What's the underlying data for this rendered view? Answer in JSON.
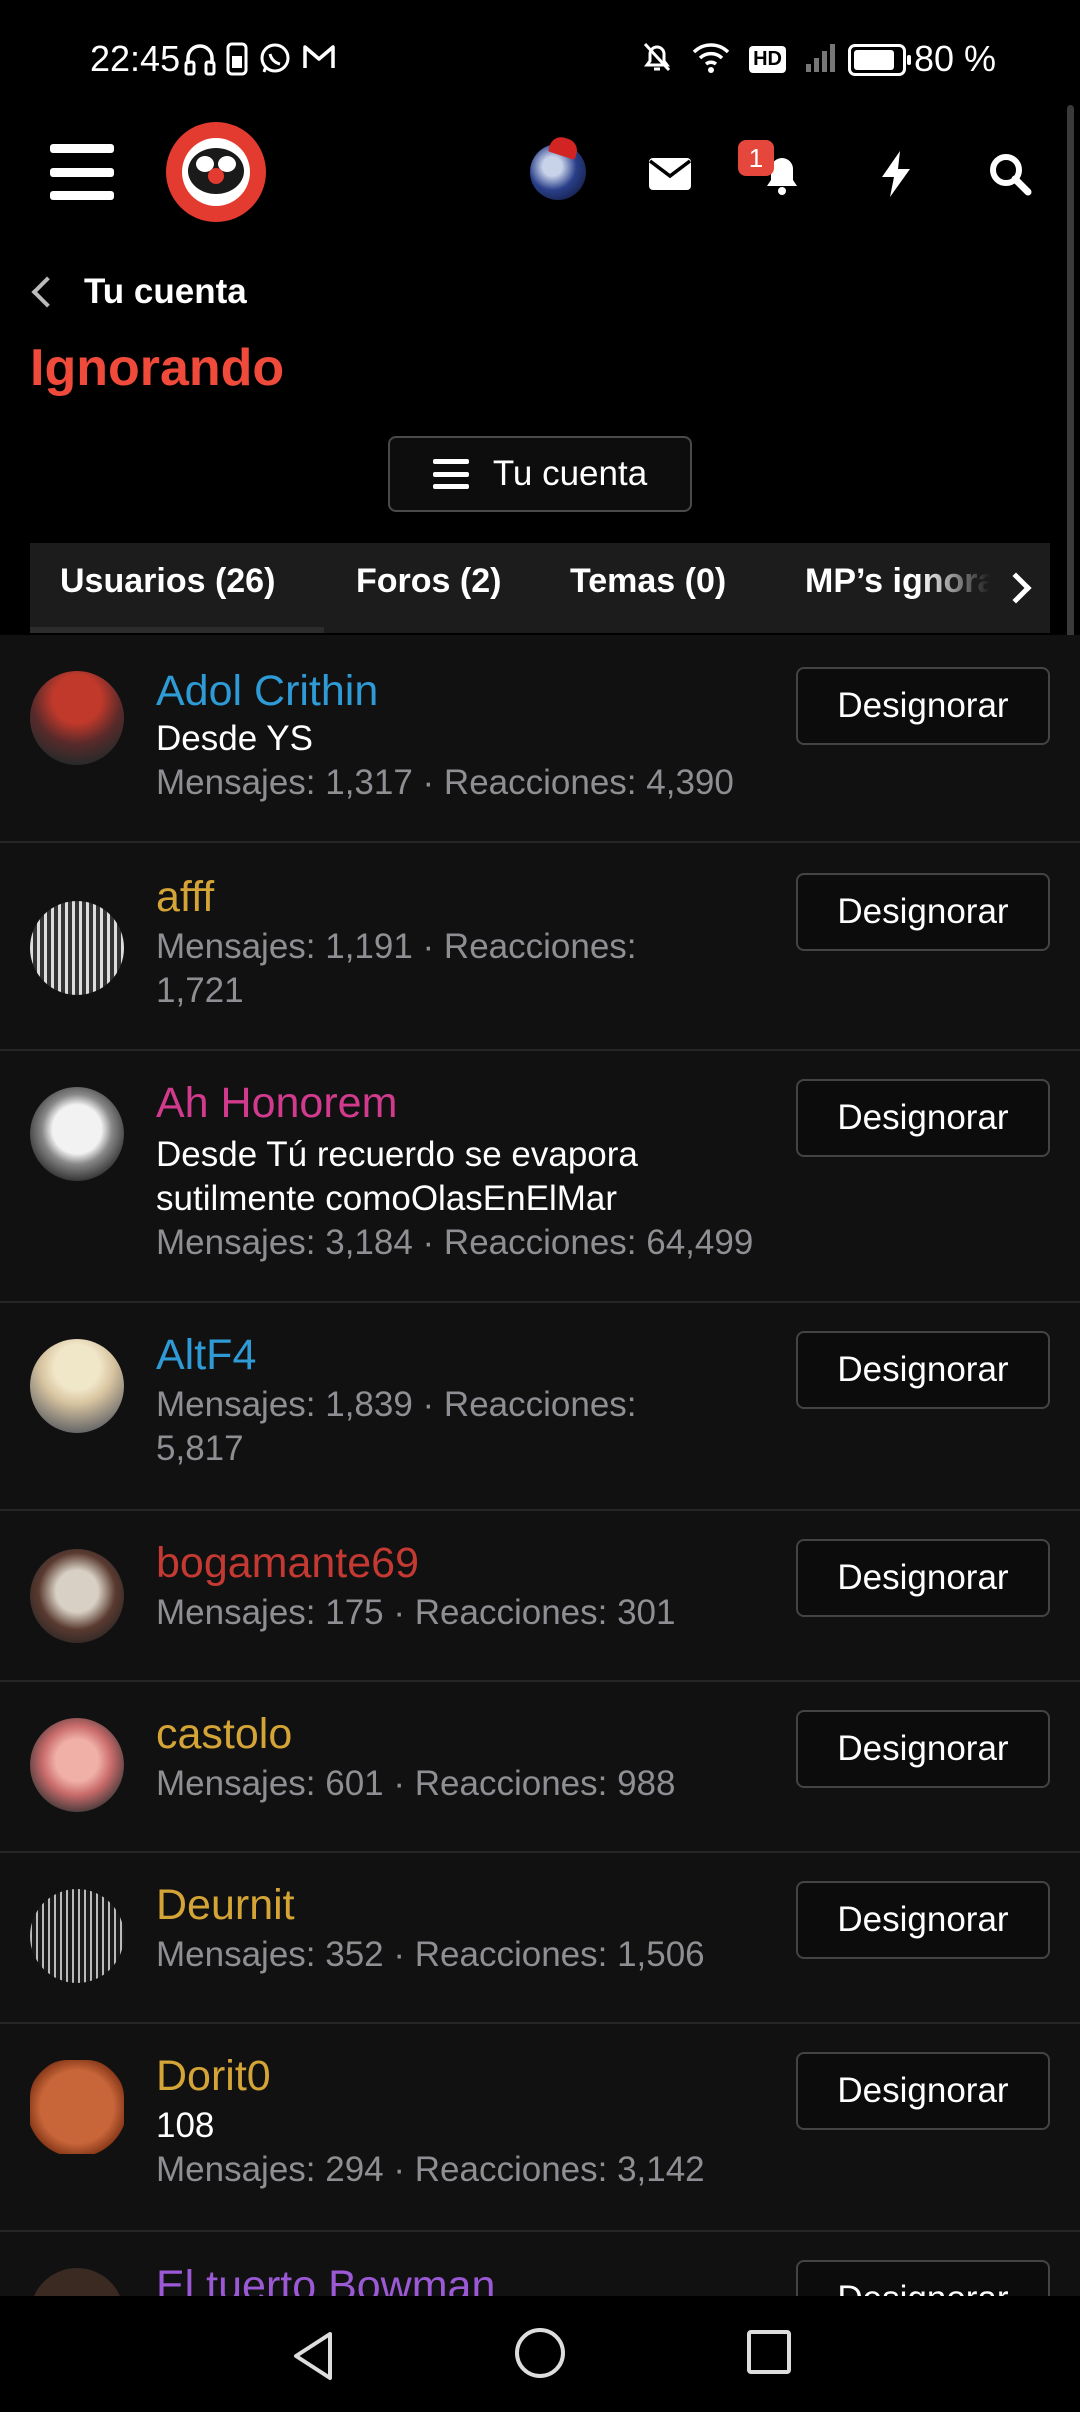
{
  "status_bar": {
    "time": "22:45",
    "battery_text": "80 %",
    "battery_level": 0.8,
    "hd_label": "HD",
    "left_icons": [
      "headphones-icon",
      "phone-icon",
      "whatsapp-icon",
      "gmail-icon"
    ],
    "right_icons": [
      "mute-icon",
      "wifi-icon",
      "hd-icon",
      "signal-icon",
      "battery-icon"
    ]
  },
  "header": {
    "icons": [
      "menu-icon",
      "site-logo",
      "user-avatar",
      "envelope-icon",
      "bell-icon",
      "bolt-icon",
      "search-icon"
    ],
    "notification_count": "1"
  },
  "breadcrumb": {
    "label": "Tu cuenta"
  },
  "page": {
    "title": "Ignorando"
  },
  "account_menu": {
    "label": "Tu cuenta"
  },
  "tabs": [
    {
      "label": "Usuarios (26)",
      "active": true
    },
    {
      "label": "Foros (2)",
      "active": false
    },
    {
      "label": "Temas (0)",
      "active": false
    },
    {
      "label": "MP’s ignorados",
      "active": false
    }
  ],
  "button_label": "Designorar",
  "users": [
    {
      "name": "Adol Crithin",
      "name_color": "#2e9bd6",
      "title": "Desde YS",
      "stats": "Mensajes: 1,317 · Reacciones: 4,390"
    },
    {
      "name": "afff",
      "name_color": "#d4a437",
      "title": "",
      "stats": "Mensajes: 1,191 · Reacciones: 1,721"
    },
    {
      "name": "Ah Honorem",
      "name_color": "#d23a8e",
      "title": "Desde Tú recuerdo se evapora sutilmente comoOlasEnElMar",
      "stats": "Mensajes: 3,184 · Reacciones: 64,499"
    },
    {
      "name": "AltF4",
      "name_color": "#2e9bd6",
      "title": "",
      "stats": "Mensajes: 1,839 · Reacciones: 5,817"
    },
    {
      "name": "bogamante69",
      "name_color": "#c43a32",
      "title": "",
      "stats": "Mensajes: 175 · Reacciones: 301"
    },
    {
      "name": "castolo",
      "name_color": "#d4a437",
      "title": "",
      "stats": "Mensajes: 601 · Reacciones: 988"
    },
    {
      "name": "Deurnit",
      "name_color": "#d4a437",
      "title": "",
      "stats": "Mensajes: 352 · Reacciones: 1,506"
    },
    {
      "name": "Dorit0",
      "name_color": "#d4a437",
      "title": "108",
      "stats": "Mensajes: 294 · Reacciones: 3,142"
    },
    {
      "name": "El tuerto Bowman",
      "name_color": "#9b59d6",
      "title": "",
      "stats": ""
    }
  ],
  "navbar": {
    "icons": [
      "back-icon",
      "home-icon",
      "recents-icon"
    ]
  }
}
